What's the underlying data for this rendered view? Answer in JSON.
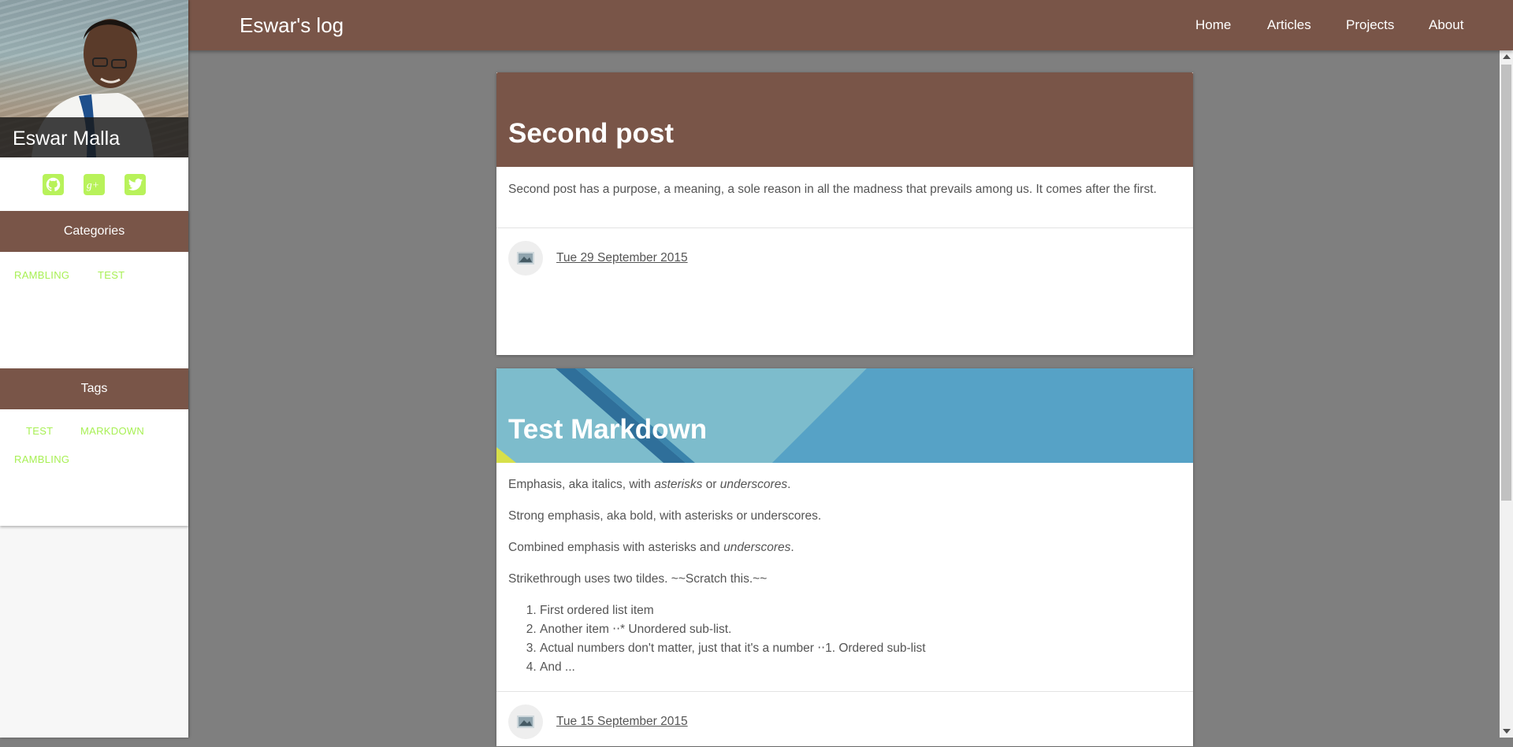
{
  "sidebar": {
    "profile_name": "Eswar Malla",
    "social": [
      "github-icon",
      "google-plus-icon",
      "twitter-icon"
    ],
    "categories": {
      "title": "Categories",
      "items": [
        "RAMBLING",
        "TEST"
      ]
    },
    "tags": {
      "title": "Tags",
      "items": [
        "TEST",
        "MARKDOWN",
        "RAMBLING"
      ]
    }
  },
  "topbar": {
    "brand": "Eswar's log",
    "nav": [
      "Home",
      "Articles",
      "Projects",
      "About"
    ]
  },
  "posts": [
    {
      "title": "Second post",
      "summary": "Second post has a purpose, a meaning, a sole reason in all the madness that prevails among us. It comes after the first.",
      "date": "Tue 29 September 2015"
    },
    {
      "title": "Test Markdown",
      "p1_pre": "Emphasis, aka italics, with ",
      "p1_em1": "asterisks",
      "p1_mid": " or ",
      "p1_em2": "underscores",
      "p1_post": ".",
      "p2": "Strong emphasis, aka bold, with asterisks or underscores.",
      "p3_pre": "Combined emphasis with asterisks and ",
      "p3_em": "underscores",
      "p3_post": ".",
      "p4": "Strikethrough uses two tildes. ~~Scratch this.~~",
      "list": [
        "First ordered list item",
        "Another item ⋅⋅* Unordered sub-list.",
        "Actual numbers don't matter, just that it's a number ⋅⋅1. Ordered sub-list",
        "And ..."
      ],
      "date": "Tue 15 September 2015"
    }
  ],
  "colors": {
    "primary": "#795548",
    "accent": "#a8f055",
    "background": "#7f7f7f"
  }
}
